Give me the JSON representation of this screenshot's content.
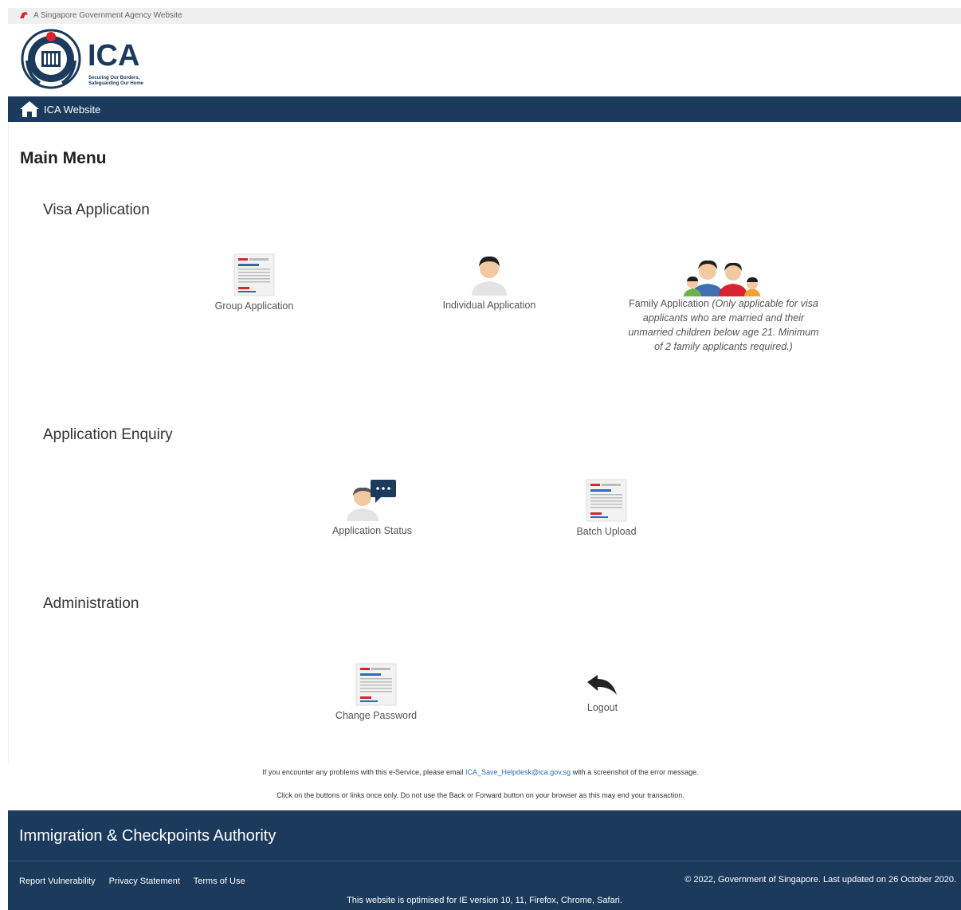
{
  "masthead": {
    "text": "A Singapore Government Agency Website"
  },
  "logo": {
    "name": "ICA",
    "tagline1": "Securing Our Borders,",
    "tagline2": "Safeguarding Our Home"
  },
  "nav": {
    "home_label": "ICA Website"
  },
  "main": {
    "title": "Main Menu",
    "sections": [
      {
        "heading": "Visa Application"
      },
      {
        "heading": "Application Enquiry"
      },
      {
        "heading": "Administration"
      }
    ],
    "tiles": {
      "group": "Group Application",
      "individual": "Individual Application",
      "family": "Family Application",
      "family_note": "(Only applicable for visa applicants who are married and their unmarried children below age 21. Minimum of 2 family applicants required.)",
      "status": "Application Status",
      "batch": "Batch Upload",
      "password": "Change Password",
      "logout": "Logout"
    }
  },
  "notes": {
    "line1_pre": "If you encounter any problems with this e-Service, please email",
    "email": "ICA_Save_Helpdesk@ica.gov.sg",
    "line1_post": "with a screenshot of the error message.",
    "line2": "Click on the buttons or links once only. Do not use the Back or Forward button on your browser as this may end your transaction."
  },
  "footer": {
    "agency": "Immigration & Checkpoints Authority",
    "links": [
      "Report Vulnerability",
      "Privacy Statement",
      "Terms of Use"
    ],
    "copyright": "© 2022, Government of Singapore. Last updated on 26 October 2020.",
    "optimised": "This website is optimised for IE version 10, 11, Firefox, Chrome, Safari."
  },
  "colors": {
    "navy": "#1b3a5c",
    "red": "#d9232e",
    "link": "#2a6db5"
  },
  "icons": [
    "lion-head-icon",
    "home-icon",
    "document-icon",
    "person-icon",
    "family-icon",
    "chat-person-icon",
    "logout-arrow-icon"
  ]
}
